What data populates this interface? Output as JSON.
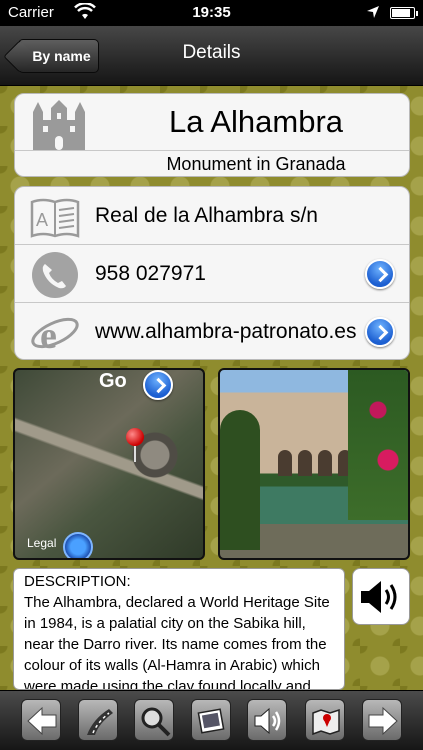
{
  "status_bar": {
    "carrier": "Carrier",
    "time": "19:35"
  },
  "nav": {
    "back_label": "By name",
    "title": "Details"
  },
  "place": {
    "name": "La Alhambra",
    "subtitle": "Monument in Granada"
  },
  "info": {
    "address": "Real de la Alhambra s/n",
    "phone": "958 027971",
    "website": "www.alhambra-patronato.es"
  },
  "map": {
    "go_label": "Go",
    "legal_label": "Legal"
  },
  "description": {
    "heading": "DESCRIPTION:",
    "text": "The Alhambra, declared a World Heritage Site in 1984, is a palatial city on the Sabika hill, near the Darro river. Its name comes from the colour of its walls (Al-Hamra in Arabic) which were made using the clay found locally and the reddish tint this"
  },
  "icons": {
    "castle": "castle-icon",
    "book": "book-icon",
    "phone": "phone-icon",
    "browser": "browser-icon",
    "sound": "speaker-icon"
  },
  "toolbar": {
    "items": [
      "back-arrow-icon",
      "road-icon",
      "search-map-icon",
      "photo-icon",
      "speaker-icon",
      "map-icon",
      "forward-arrow-icon"
    ]
  },
  "colors": {
    "background": "#8e8a2c",
    "accent_blue": "#1c5fd1"
  }
}
